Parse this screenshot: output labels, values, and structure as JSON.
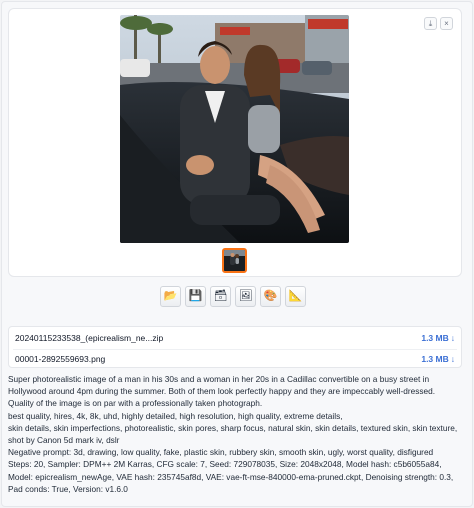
{
  "gallery": {
    "download_icon": "download-icon",
    "close_icon": "close-icon",
    "download_glyph": "⤓",
    "close_glyph": "×"
  },
  "toolbar": {
    "buttons": [
      {
        "name": "open-folder-button",
        "icon": "folder-icon",
        "glyph": "📂"
      },
      {
        "name": "save-button",
        "icon": "floppy-disk-icon",
        "glyph": "💾"
      },
      {
        "name": "zip-button",
        "icon": "archive-box-icon",
        "glyph": "🗃"
      },
      {
        "name": "send-to-img2img-button",
        "icon": "picture-icon",
        "glyph": "🖼"
      },
      {
        "name": "send-to-inpaint-button",
        "icon": "palette-icon",
        "glyph": "🎨"
      },
      {
        "name": "send-to-extras-button",
        "icon": "triangle-ruler-icon",
        "glyph": "📐"
      }
    ]
  },
  "files": [
    {
      "name": "20240115233538_(epicrealism_ne...zip",
      "size": "1.3 MB",
      "arrow": "↓"
    },
    {
      "name": "00001-2892559693.png",
      "size": "1.3 MB",
      "arrow": "↓"
    }
  ],
  "info": {
    "prompt": "Super photorealistic image of a man in his 30s and a woman in her 20s in a Cadillac convertible on a busy street in Hollywood around 4pm during the summer. Both of them look perfectly happy and they are impeccably well-dressed. Quality of the image is on par with a professionally taken photograph.",
    "quality": "best quality, hires, 4k, 8k, uhd, highly detailed, high resolution, high quality, extreme details,",
    "skin": "skin details, skin imperfections, photorealistic, skin pores, sharp focus, natural skin, skin details, textured skin, skin texture,",
    "shot": "shot by Canon 5d mark iv, dslr",
    "negative": "Negative prompt: 3d, drawing, low quality, fake, plastic skin, rubbery skin, smooth skin, ugly, worst quality, disfigured",
    "params": "Steps: 20, Sampler: DPM++ 2M Karras, CFG scale: 7, Seed: 729078035, Size: 2048x2048, Model hash: c5b6055a84, Model: epicrealism_newAge, VAE hash: 235745af8d, VAE: vae-ft-mse-840000-ema-pruned.ckpt, Denoising strength: 0.3, Pad conds: True, Version: v1.6.0"
  }
}
